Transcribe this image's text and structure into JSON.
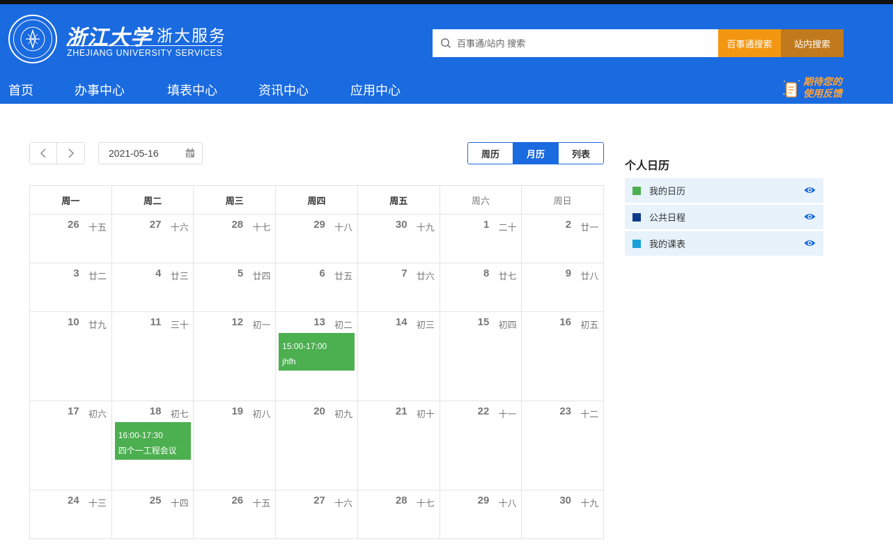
{
  "header": {
    "logo_cn": "浙江大学",
    "logo_service": "浙大服务",
    "logo_en": "ZHEJIANG UNIVERSITY SERVICES",
    "search_placeholder": "百事通/站内 搜索",
    "btn_baishitong": "百事通搜索",
    "btn_site": "站内搜索",
    "feedback_line1": "期待您的",
    "feedback_line2": "使用反馈"
  },
  "nav": [
    "首页",
    "办事中心",
    "填表中心",
    "资讯中心",
    "应用中心"
  ],
  "toolbar": {
    "date": "2021-05-16",
    "views": [
      {
        "label": "周历",
        "active": false
      },
      {
        "label": "月历",
        "active": true
      },
      {
        "label": "列表",
        "active": false
      }
    ]
  },
  "calendar": {
    "weekdays": [
      "周一",
      "周二",
      "周三",
      "周四",
      "周五",
      "周六",
      "周日"
    ],
    "weeks": [
      [
        [
          "26",
          "十五"
        ],
        [
          "27",
          "十六"
        ],
        [
          "28",
          "十七"
        ],
        [
          "29",
          "十八"
        ],
        [
          "30",
          "十九"
        ],
        [
          "1",
          "二十"
        ],
        [
          "2",
          "廿一"
        ]
      ],
      [
        [
          "3",
          "廿二"
        ],
        [
          "4",
          "廿三"
        ],
        [
          "5",
          "廿四"
        ],
        [
          "6",
          "廿五"
        ],
        [
          "7",
          "廿六"
        ],
        [
          "8",
          "廿七"
        ],
        [
          "9",
          "廿八"
        ]
      ],
      [
        [
          "10",
          "廿九"
        ],
        [
          "11",
          "三十"
        ],
        [
          "12",
          "初一"
        ],
        [
          "13",
          "初二"
        ],
        [
          "14",
          "初三"
        ],
        [
          "15",
          "初四"
        ],
        [
          "16",
          "初五"
        ]
      ],
      [
        [
          "17",
          "初六"
        ],
        [
          "18",
          "初七"
        ],
        [
          "19",
          "初八"
        ],
        [
          "20",
          "初九"
        ],
        [
          "21",
          "初十"
        ],
        [
          "22",
          "十一"
        ],
        [
          "23",
          "十二"
        ]
      ],
      [
        [
          "24",
          "十三"
        ],
        [
          "25",
          "十四"
        ],
        [
          "26",
          "十五"
        ],
        [
          "27",
          "十六"
        ],
        [
          "28",
          "十七"
        ],
        [
          "29",
          "十八"
        ],
        [
          "30",
          "十九"
        ]
      ]
    ],
    "events": [
      {
        "week": 2,
        "day": 3,
        "time": "15:00-17:00",
        "title": "jhfh",
        "color": "#4caf50"
      },
      {
        "week": 3,
        "day": 1,
        "time": "16:00-17:30",
        "title": "四个一工程会议",
        "color": "#4caf50"
      }
    ]
  },
  "sidebar": {
    "title": "个人日历",
    "items": [
      {
        "label": "我的日历",
        "color": "#4caf50"
      },
      {
        "label": "公共日程",
        "color": "#0d3a8a"
      },
      {
        "label": "我的课表",
        "color": "#1aa0d8"
      }
    ]
  }
}
